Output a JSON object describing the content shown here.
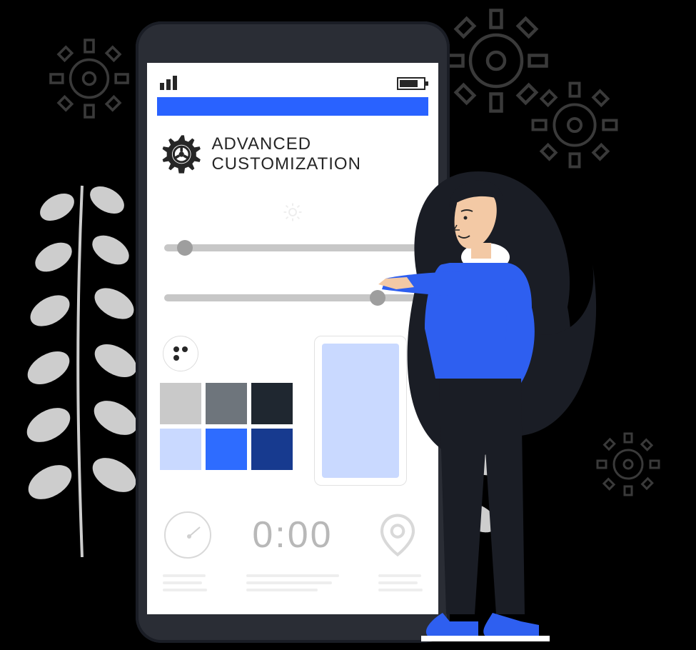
{
  "header": {
    "title": "ADVANCED CUSTOMIZATION",
    "title_icon": "gear-icon"
  },
  "sliders": {
    "brightness": {
      "value": 5,
      "min": 0,
      "max": 100
    },
    "secondary": {
      "value": 80,
      "min": 0,
      "max": 100
    }
  },
  "palette": {
    "swatches": [
      "#c9c9c9",
      "#6e757c",
      "#1f2730",
      "#c9d9ff",
      "#2e6cff",
      "#173a8f"
    ]
  },
  "preview": {
    "color": "#c9d9ff"
  },
  "clock": {
    "time": "0:00"
  },
  "status": {
    "signal_bars": 3,
    "battery_pct": 70
  }
}
